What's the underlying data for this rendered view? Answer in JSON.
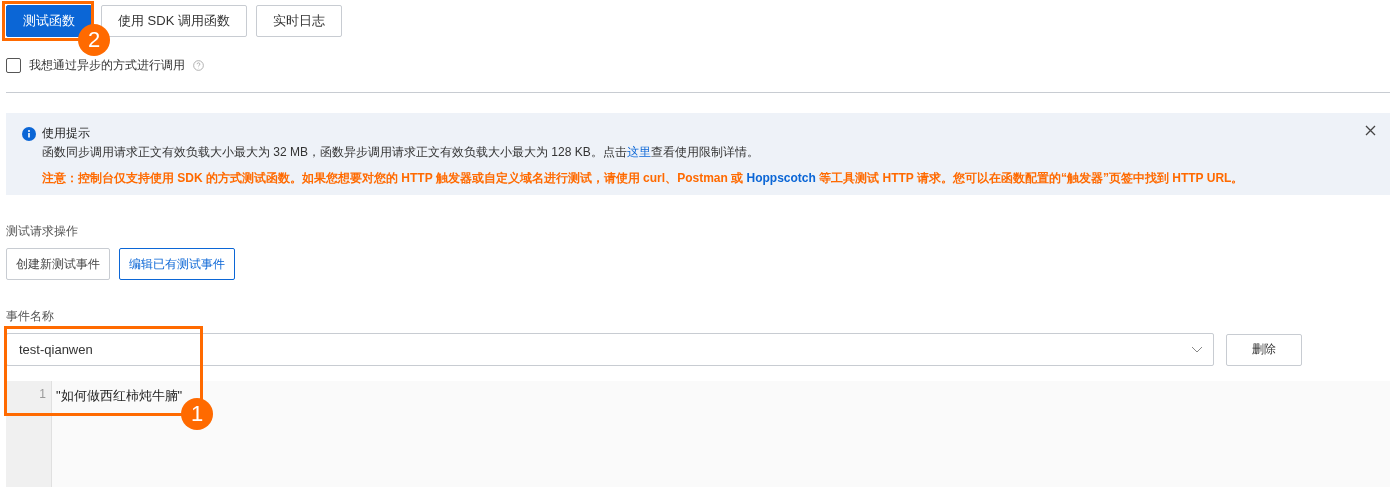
{
  "tabs": [
    {
      "label": "测试函数",
      "selected": true
    },
    {
      "label": "使用 SDK 调用函数",
      "selected": false
    },
    {
      "label": "实时日志",
      "selected": false
    }
  ],
  "async_option": {
    "label": "我想通过异步的方式进行调用",
    "checked": false
  },
  "notice": {
    "title": "使用提示",
    "line_before": "函数同步调用请求正文有效负载大小最大为 32 MB，函数异步调用请求正文有效负载大小最大为 128 KB。点击",
    "link": "这里",
    "line_after": "查看使用限制详情。",
    "warning_before": "注意：控制台仅支持使用 SDK 的方式测试函数。如果您想要对您的 HTTP 触发器或自定义域名进行测试，请使用 curl、Postman 或 ",
    "warning_link": "Hoppscotch",
    "warning_after": " 等工具测试 HTTP 请求。您可以在函数配置的“触发器”页签中找到 HTTP URL。"
  },
  "test_actions": {
    "label": "测试请求操作",
    "options": [
      {
        "label": "创建新测试事件",
        "selected": false
      },
      {
        "label": "编辑已有测试事件",
        "selected": true
      }
    ]
  },
  "event": {
    "label": "事件名称",
    "value": "test-qianwen",
    "delete_button": "删除"
  },
  "editor": {
    "lines": [
      {
        "number": "1",
        "code": "\"如何做西红柿炖牛腩\""
      }
    ]
  },
  "annotations": [
    {
      "number": "2"
    },
    {
      "number": "1"
    }
  ]
}
